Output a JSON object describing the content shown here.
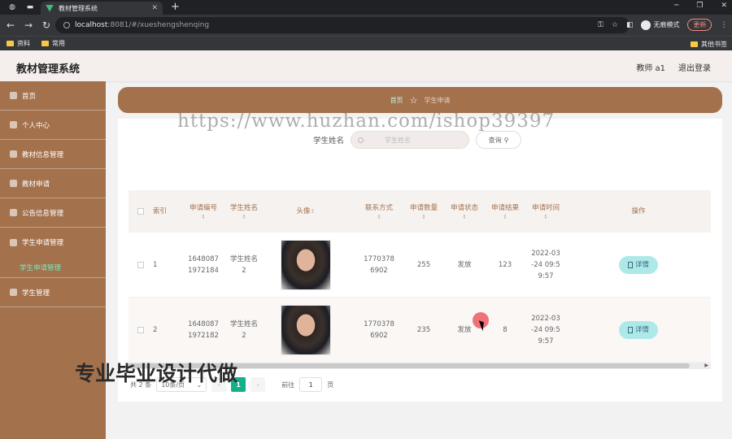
{
  "browser": {
    "tab_title": "教材管理系统",
    "url_host": "localhost",
    "url_rest": ":8081/#/xueshengshenqing",
    "incognito_label": "无痕模式",
    "update_label": "更新",
    "bookmarks": [
      "资料",
      "常用"
    ],
    "other_bookmarks": "其他书签"
  },
  "header": {
    "brand": "教材管理系统",
    "user": "教师 a1",
    "logout": "退出登录"
  },
  "sidebar": {
    "items": [
      {
        "label": "首页",
        "icon": "home-icon"
      },
      {
        "label": "个人中心",
        "icon": "user-icon"
      },
      {
        "label": "教材信息管理",
        "icon": "book-icon"
      },
      {
        "label": "教材申请",
        "icon": "apply-icon"
      },
      {
        "label": "公告信息管理",
        "icon": "notice-icon"
      },
      {
        "label": "学生申请管理",
        "icon": "student-apply-icon"
      },
      {
        "label": "学生管理",
        "icon": "student-icon"
      }
    ],
    "sub_item": "学生申请管理"
  },
  "breadcrumb": {
    "home": "首页",
    "current": "学生申请"
  },
  "search": {
    "label": "学生姓名",
    "placeholder": "学生姓名",
    "button": "查询"
  },
  "table": {
    "headers": [
      "索引",
      "申请编号",
      "学生姓名",
      "头像",
      "联系方式",
      "申请数量",
      "申请状态",
      "申请结果",
      "申请时间",
      "操作"
    ],
    "rows": [
      {
        "index": "1",
        "number": "1648087\n1972184",
        "name": "学生姓名\n2",
        "phone": "1770378\n6902",
        "qty": "255",
        "status": "发放",
        "result": "123",
        "time": "2022-03\n-24 09:5\n9:57",
        "action": "详情"
      },
      {
        "index": "2",
        "number": "1648087\n1972182",
        "name": "学生姓名\n2",
        "phone": "1770378\n6902",
        "qty": "235",
        "status": "发放",
        "result": "8",
        "time": "2022-03\n-24 09:5\n9:57",
        "action": "详情"
      }
    ]
  },
  "pager": {
    "total": "共 2 条",
    "size": "10条/页",
    "current": "1",
    "goto_label": "前往",
    "goto_value": "1",
    "page_unit": "页"
  },
  "watermarks": {
    "url": "https://www.huzhan.com/ishop39397",
    "promo": "专业毕业设计代做"
  },
  "colors": {
    "sidebar": "#a4714d",
    "accent": "#14b08a",
    "detail_button": "#aee9ea"
  }
}
